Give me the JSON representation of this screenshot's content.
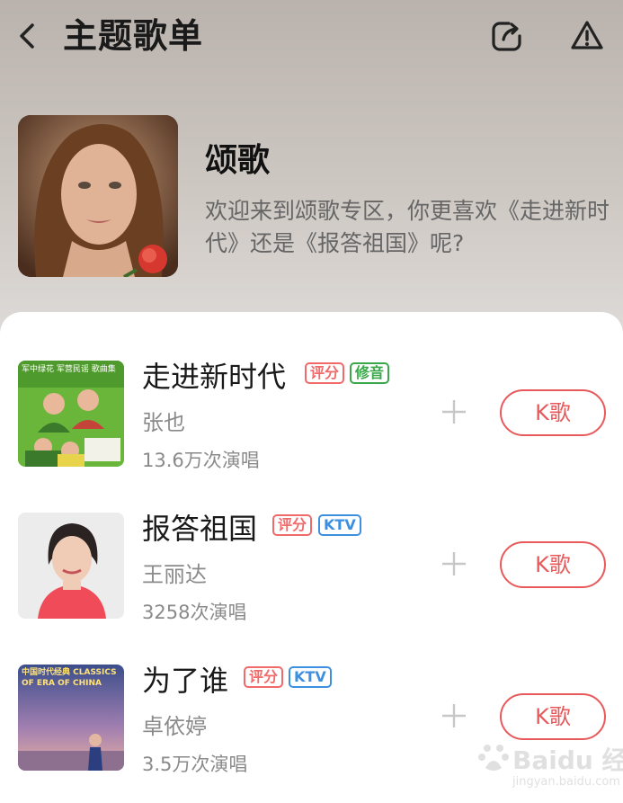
{
  "header": {
    "title": "主题歌单",
    "icons": [
      "chevron-left-icon",
      "share-icon",
      "warning-icon"
    ]
  },
  "playlist": {
    "name": "颂歌",
    "description": "欢迎来到颂歌专区，你更喜欢《走进新时代》还是《报答祖国》呢?"
  },
  "songs": [
    {
      "title": "走进新时代",
      "tags": [
        "评分",
        "修音"
      ],
      "artist": "张也",
      "count": "13.6万次演唱",
      "k_label": "K歌",
      "cover_text": "军中绿花 军营民谣 歌曲集"
    },
    {
      "title": "报答祖国",
      "tags": [
        "评分",
        "KTV"
      ],
      "artist": "王丽达",
      "count": "3258次演唱",
      "k_label": "K歌"
    },
    {
      "title": "为了谁",
      "tags": [
        "评分",
        "KTV"
      ],
      "artist": "卓依婷",
      "count": "3.5万次演唱",
      "k_label": "K歌",
      "cover_text": "中国时代经典 CLASSICS OF ERA OF CHINA"
    }
  ],
  "watermark": {
    "text": "Baidu 经验",
    "sub": "jingyan.baidu.com"
  },
  "colors": {
    "accent": "#e8595b",
    "tag_score": "#f06a6a",
    "tag_fix": "#3aa84a",
    "tag_ktv": "#3d8fe0"
  }
}
